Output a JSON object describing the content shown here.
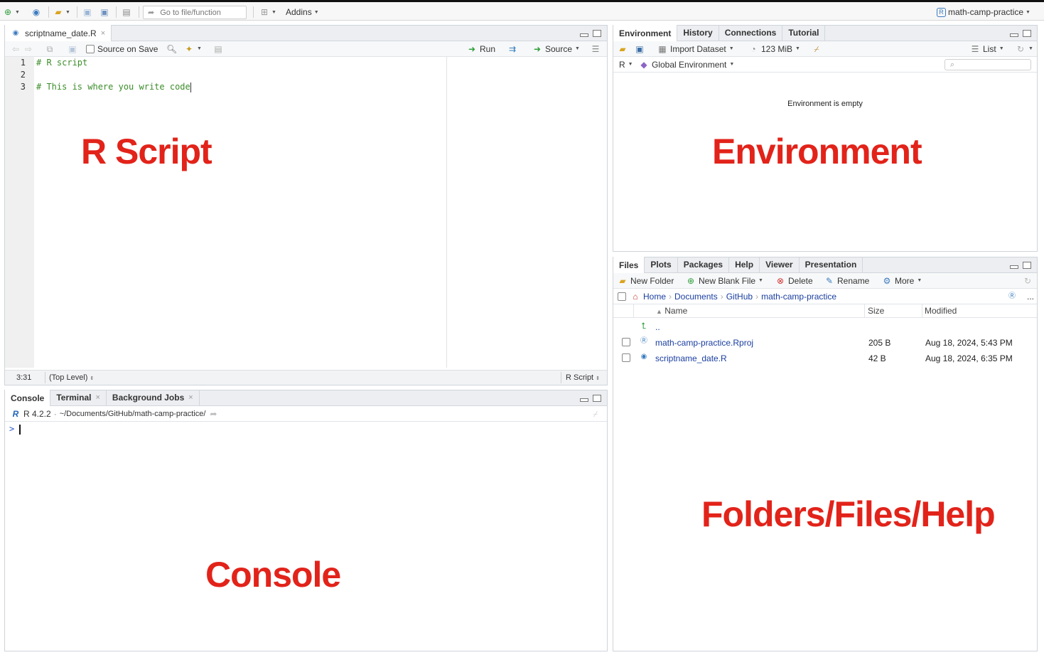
{
  "topbar": {
    "goto_placeholder": "Go to file/function",
    "addins_label": "Addins",
    "project_label": "math-camp-practice"
  },
  "source_pane": {
    "tab_label": "scriptname_date.R",
    "source_on_save": "Source on Save",
    "run_label": "Run",
    "source_label": "Source",
    "line_numbers": [
      "1",
      "2",
      "3"
    ],
    "lines": [
      "# R script",
      "",
      "# This is where you write code"
    ],
    "status_position": "3:31",
    "status_scope": "(Top Level)",
    "status_filetype": "R Script"
  },
  "console_pane": {
    "tabs": [
      "Console",
      "Terminal",
      "Background Jobs"
    ],
    "r_version": "R 4.2.2",
    "working_dir": "~/Documents/GitHub/math-camp-practice/",
    "prompt": ">"
  },
  "environment_pane": {
    "tabs": [
      "Environment",
      "History",
      "Connections",
      "Tutorial"
    ],
    "import_dataset": "Import Dataset",
    "memory": "123 MiB",
    "view_mode": "List",
    "language": "R",
    "scope": "Global Environment",
    "empty_message": "Environment is empty"
  },
  "files_pane": {
    "tabs": [
      "Files",
      "Plots",
      "Packages",
      "Help",
      "Viewer",
      "Presentation"
    ],
    "new_folder": "New Folder",
    "new_blank_file": "New Blank File",
    "delete": "Delete",
    "rename": "Rename",
    "more": "More",
    "breadcrumb": [
      "Home",
      "Documents",
      "GitHub",
      "math-camp-practice"
    ],
    "more_path": "...",
    "columns": [
      "Name",
      "Size",
      "Modified"
    ],
    "parent_dir": "..",
    "files": [
      {
        "name": "math-camp-practice.Rproj",
        "size": "205 B",
        "modified": "Aug 18, 2024, 5:43 PM"
      },
      {
        "name": "scriptname_date.R",
        "size": "42 B",
        "modified": "Aug 18, 2024, 6:35 PM"
      }
    ]
  },
  "overlays": {
    "script": "R Script",
    "environment": "Environment",
    "console": "Console",
    "files": "Folders/Files/Help"
  },
  "colors": {
    "overlay_red": "#e2231a",
    "comment_green": "#3c8d2a",
    "link_blue": "#1a3ea0"
  }
}
